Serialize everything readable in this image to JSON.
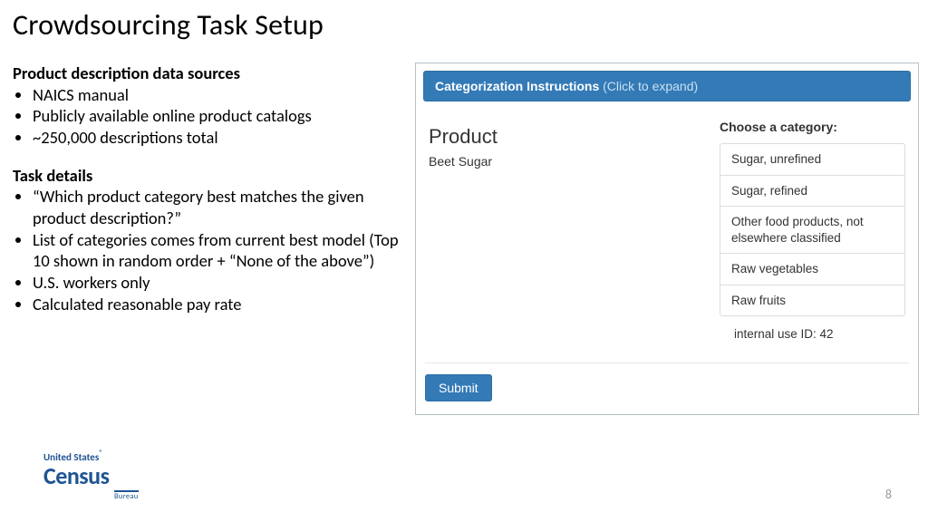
{
  "title": "Crowdsourcing Task Setup",
  "left": {
    "h1": "Product description data sources",
    "bullets1": [
      "NAICS manual",
      "Publicly available online product catalogs",
      "~250,000 descriptions total"
    ],
    "h2": "Task details",
    "bullets2": [
      "“Which product category best matches the given product description?”",
      "List of categories comes from current best model (Top 10 shown in random order + “None of the above”)",
      "U.S. workers only",
      "Calculated reasonable pay rate"
    ]
  },
  "ui": {
    "header_bold": "Categorization Instructions",
    "header_sub": "(Click to expand)",
    "product_label": "Product",
    "product_value": "Beet Sugar",
    "choose_label": "Choose a category:",
    "categories": [
      "Sugar, unrefined",
      "Sugar, refined",
      "Other food products, not elsewhere classified",
      "Raw vegetables",
      "Raw fruits"
    ],
    "internal_id": "internal use ID: 42",
    "submit": "Submit"
  },
  "logo": {
    "line1": "United States",
    "reg": "®",
    "line2": "Census",
    "line3": "Bureau"
  },
  "page_number": "8"
}
